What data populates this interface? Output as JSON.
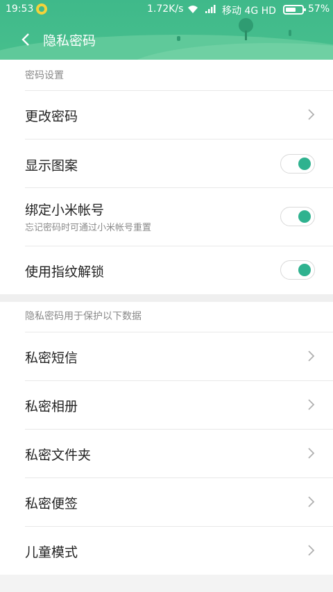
{
  "status_bar": {
    "time": "19:53",
    "speed": "1.72K/s",
    "carrier": "移动 4G HD",
    "battery_percent": "57%"
  },
  "header": {
    "title": "隐私密码",
    "back_icon": "chevron-left-icon"
  },
  "password_section": {
    "header": "密码设置",
    "items": [
      {
        "label": "更改密码",
        "control": "chevron"
      },
      {
        "label": "显示图案",
        "control": "toggle",
        "on": true
      },
      {
        "label": "绑定小米帐号",
        "sublabel": "忘记密码时可通过小米帐号重置",
        "control": "toggle",
        "on": true
      },
      {
        "label": "使用指纹解锁",
        "control": "toggle",
        "on": true
      }
    ]
  },
  "protect_section": {
    "header": "隐私密码用于保护以下数据",
    "items": [
      {
        "label": "私密短信"
      },
      {
        "label": "私密相册"
      },
      {
        "label": "私密文件夹"
      },
      {
        "label": "私密便签"
      },
      {
        "label": "儿童模式"
      }
    ]
  },
  "colors": {
    "header_green": "#3fb98a",
    "toggle_knob": "#2fb28f"
  }
}
